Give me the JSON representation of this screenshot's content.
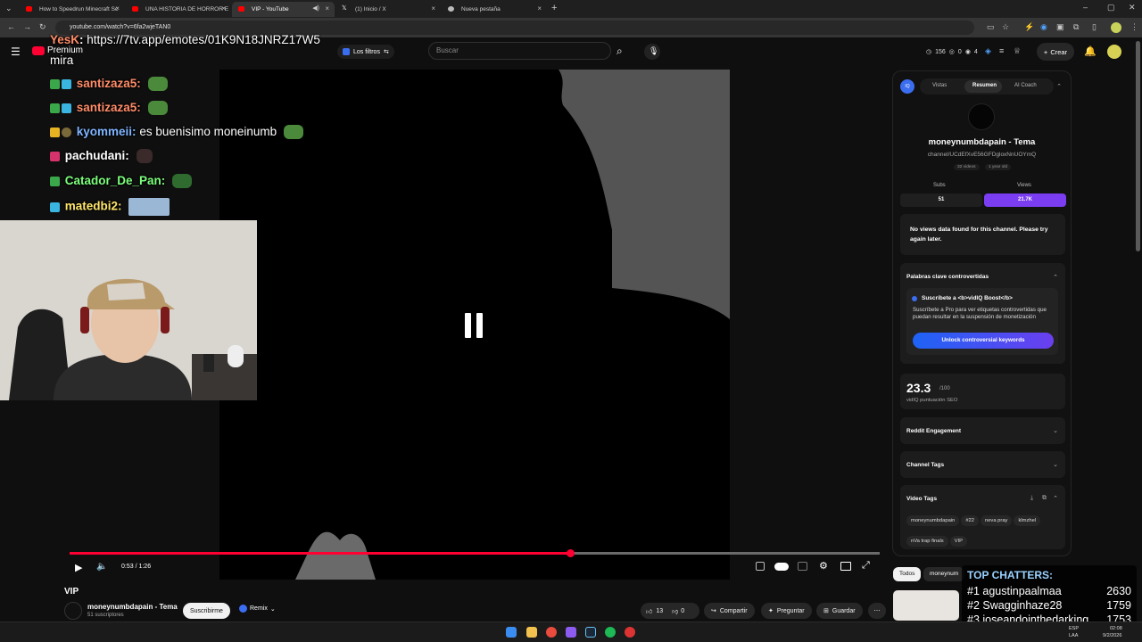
{
  "browser": {
    "tabs": [
      {
        "label": "How to Speedrun Minecraft Sc",
        "favicon_color": "#ff0000"
      },
      {
        "label": "UNA HISTORIA DE HORROR E",
        "favicon_color": "#ff0000"
      },
      {
        "label": "VIP - YouTube",
        "favicon_color": "#ff0000"
      },
      {
        "label": "(1) Inicio / X",
        "favicon_color": "#ffffff"
      },
      {
        "label": "Nueva pestaña",
        "favicon_color": "#cccccc"
      }
    ],
    "new_tab_icon": "plus-icon",
    "url": "youtube.com/watch?v=6fa2wjeTAN0"
  },
  "youtube": {
    "logo_text": "Premium",
    "filters_label": "Los filtros",
    "search_placeholder": "Buscar",
    "header_stats": {
      "a": "156",
      "b": "0",
      "c": "4"
    },
    "create_label": "Crear",
    "accent": "#ff0033"
  },
  "stream_overlay": {
    "link_user": "YesK",
    "link_text": "https://7tv.app/emotes/01K9N18JNRZ17W5",
    "link_cont": "mira",
    "chat": [
      {
        "user": "santizaza5:",
        "msg": "",
        "color": "#ff8c69"
      },
      {
        "user": "santizaza5:",
        "msg": "",
        "color": "#ff8c69"
      },
      {
        "user": "kyommeii:",
        "msg": "es buenisimo moneinumb",
        "color": "#7fb5ff"
      },
      {
        "user": "pachudani:",
        "msg": "",
        "color": "#ffffff"
      },
      {
        "user": "Catador_De_Pan:",
        "msg": "",
        "color": "#7cff7c"
      },
      {
        "user": "matedbi2:",
        "msg": "",
        "color": "#ffe66b"
      }
    ]
  },
  "player": {
    "time": "0:53 / 1:26",
    "progress": 0.618
  },
  "video": {
    "title": "VIP",
    "channel": "moneynumbdapain - Tema",
    "subscribers": "51 suscriptores",
    "subscribe_label": "Suscribirme",
    "remix_label": "Remix",
    "likes": "13",
    "dislikes": "0",
    "share_label": "Compartir",
    "ask_label": "Preguntar",
    "save_label": "Guardar"
  },
  "vidiq": {
    "tabs": [
      "Vistas",
      "Resumen",
      "AI Coach"
    ],
    "active_tab": "Resumen",
    "channel_name": "moneynumbdapain - Tema",
    "channel_id": "channel/UCdEfXvE56GFDgloxNnUOYmQ",
    "videos": "32 videos",
    "age": "1 year old",
    "subs_label": "Subs",
    "subs_value": "51",
    "views_label": "Views",
    "views_value": "21.7K",
    "no_views": "No views data found for this channel. Please try again later.",
    "controversial_title": "Palabras clave controvertidas",
    "boost_title": "Suscríbete a <b>vidIQ Boost</b>",
    "boost_desc": "Suscríbete a Pro para ver etiquetas controvertidas que puedan resultar en la suspensión de monetización",
    "unlock_label": "Unlock controversial keywords",
    "seo_score": "23.3",
    "seo_max": "/100",
    "seo_label": "vidIQ puntuación SEO",
    "reddit": "Reddit Engagement",
    "channel_tags": "Channel Tags",
    "video_tags": "Video Tags",
    "tags": [
      "moneynumbdapain",
      "#22",
      "neva pray",
      "klmzhel",
      "nVa trap finals",
      "VIP"
    ]
  },
  "related": {
    "chip_all": "Todos",
    "chip_channel": "moneynum"
  },
  "top_chatters": {
    "title": "TOP CHATTERS:",
    "rows": [
      {
        "rank": "#1",
        "name": "agustinpaalmaa",
        "count": "2630"
      },
      {
        "rank": "#2",
        "name": "Swagginhaze28",
        "count": "1759"
      },
      {
        "rank": "#3",
        "name": "joseandointhedarking",
        "count": "1753"
      }
    ]
  },
  "taskbar": {
    "lang": "ESP",
    "lang2": "LAA",
    "time": "02:08",
    "date": "9/2/2026"
  }
}
